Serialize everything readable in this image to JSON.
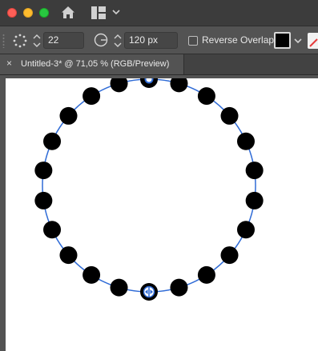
{
  "app": {
    "toolbar": {
      "count_value": "22",
      "angle_value": "120 px",
      "reverse_overlap_label": "Reverse Overlap",
      "fill_color": "#000000"
    },
    "document_tab": {
      "title": "Untitled-3* @ 71,05 % (RGB/Preview)",
      "close_glyph": "×"
    }
  },
  "artwork": {
    "guide_color": "#2f6bd6",
    "dot_color": "#000000",
    "dot_count": 22
  }
}
